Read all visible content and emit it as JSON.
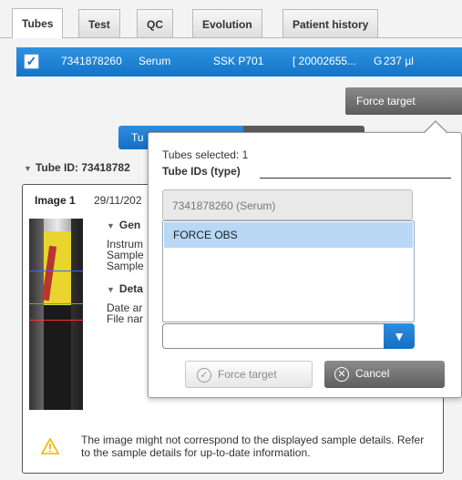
{
  "tabs": [
    {
      "label": "Tubes",
      "active": true
    },
    {
      "label": "Test",
      "active": false
    },
    {
      "label": "QC",
      "active": false
    },
    {
      "label": "Evolution",
      "active": false
    },
    {
      "label": "Patient history",
      "active": false
    }
  ],
  "tube_row": {
    "checked": true,
    "tube_number": "7341878260",
    "sample_type": "Serum",
    "rack": "SSK P701",
    "code": "[ 20002655...",
    "flag": "G",
    "volume": "237 µl"
  },
  "toolbar": {
    "force_target_label": "Force target"
  },
  "main": {
    "segment_left_label": "Tu",
    "tube_id_header": "Tube ID: 73418782",
    "image": {
      "title": "Image 1",
      "date": "29/11/202",
      "general_section": "Gen",
      "general_lines": [
        "Instrum",
        "Sample",
        "Sample"
      ],
      "details_section": "Deta",
      "details_lines": [
        "Date ar",
        "File nar"
      ]
    },
    "warning_text": "The image might not correspond to the displayed sample details. Refer to the sample details for up-to-date information."
  },
  "popup": {
    "tubes_selected": "Tubes selected: 1",
    "tube_ids_label": "Tube IDs (type)",
    "tube_id_value": "7341878260 (Serum)",
    "dropdown_options": [
      "FORCE OBS"
    ],
    "dropdown_value": "",
    "force_target_button": "Force target",
    "cancel_button": "Cancel"
  },
  "colors": {
    "accent_blue": "#1f80d6",
    "dark_button": "#5e5e5e",
    "dropdown_highlight": "#b8d8f5",
    "warning_yellow": "#f0b400"
  }
}
